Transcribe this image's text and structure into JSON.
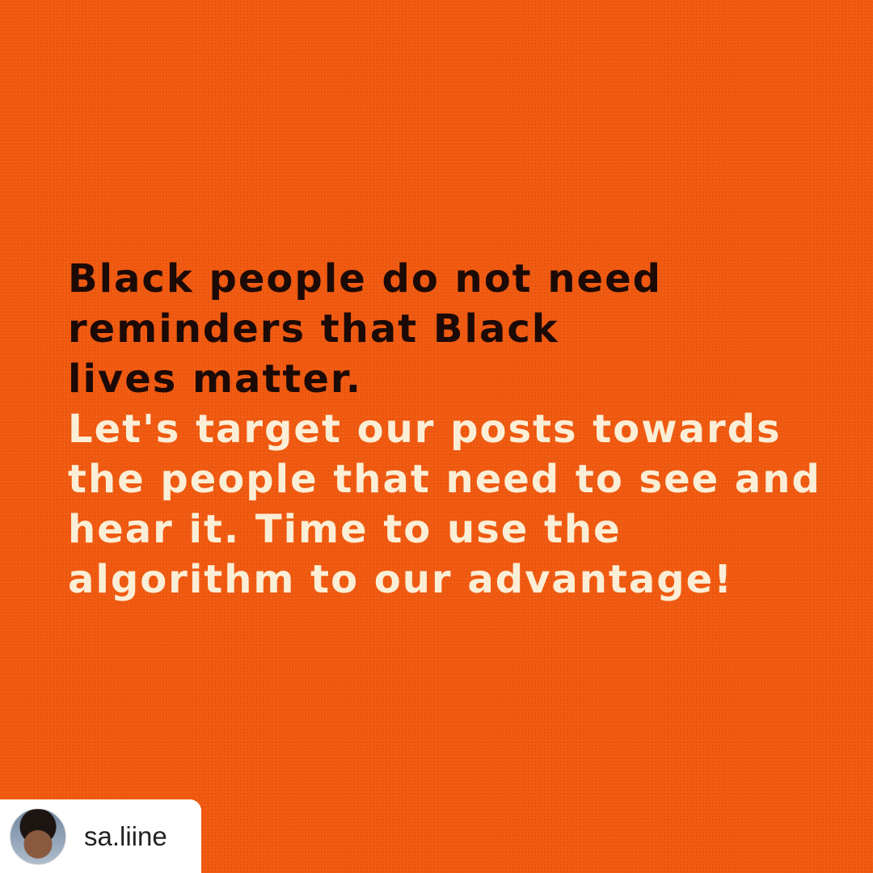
{
  "colors": {
    "background": "#f25a10",
    "dark_text": "#1c0a06",
    "light_text": "#fbeed6"
  },
  "quote": {
    "dark_lines": [
      "Black people do not need",
      "reminders that Black",
      "lives matter."
    ],
    "light_lines": [
      "Let's target our posts towards",
      "the people that need to see and",
      "hear it. Time to use the",
      "algorithm to our advantage!"
    ]
  },
  "repost": {
    "username": "sa.liine",
    "avatar_icon": "profile-photo-avatar"
  }
}
